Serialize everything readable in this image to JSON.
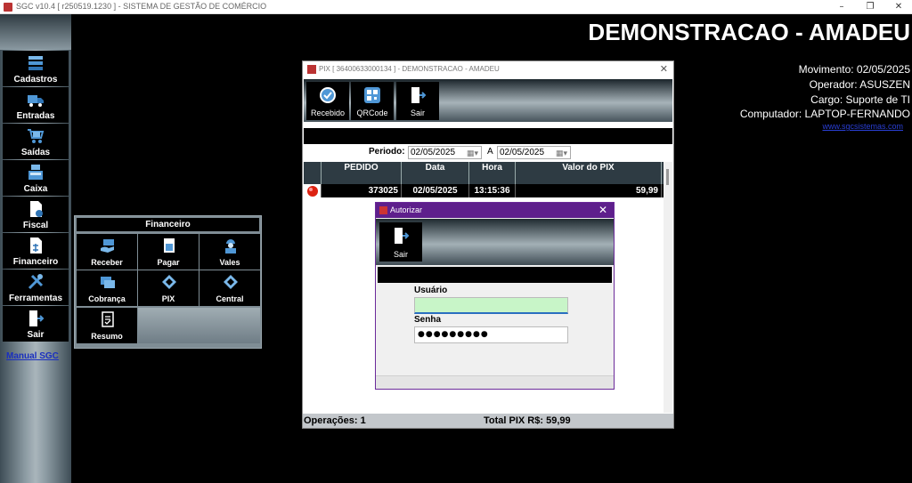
{
  "app": {
    "title": "SGC v10.4 [ r250519.1230 ] - SISTEMA DE GESTÃO DE COMÉRCIO",
    "window_controls": [
      "–",
      "❐",
      "✕"
    ]
  },
  "sidebar": {
    "items": [
      {
        "label": "Cadastros",
        "icon": "stack-icon"
      },
      {
        "label": "Entradas",
        "icon": "truck-icon"
      },
      {
        "label": "Saídas",
        "icon": "cart-icon"
      },
      {
        "label": "Caixa",
        "icon": "cash-register-icon"
      },
      {
        "label": "Fiscal",
        "icon": "document-icon"
      },
      {
        "label": "Financeiro",
        "icon": "finance-document-icon"
      },
      {
        "label": "Ferramentas",
        "icon": "tools-icon"
      },
      {
        "label": "Sair",
        "icon": "exit-door-icon"
      }
    ],
    "manual_link": "Manual SGC"
  },
  "financeiro_panel": {
    "title": "Financeiro",
    "buttons": [
      {
        "label": "Receber",
        "icon": "receive-money-icon"
      },
      {
        "label": "Pagar",
        "icon": "pay-icon"
      },
      {
        "label": "Vales",
        "icon": "worker-icon"
      },
      {
        "label": "Cobrança",
        "icon": "billing-icon"
      },
      {
        "label": "PIX",
        "icon": "pix-icon"
      },
      {
        "label": "Central",
        "icon": "pix-icon"
      },
      {
        "label": "Resumo",
        "icon": "summary-icon"
      }
    ]
  },
  "header": {
    "company": "DEMONSTRACAO - AMADEU",
    "movimento": "Movimento: 02/05/2025",
    "operador": "Operador: ASUSZEN",
    "cargo": "Cargo: Suporte de TI",
    "computador": "Computador: LAPTOP-FERNANDO",
    "site": "www.sgcsistemas.com"
  },
  "pix_window": {
    "title": "PIX [ 36400633000134 ] - DEMONSTRACAO - AMADEU",
    "toolbar": [
      {
        "label": "Recebido",
        "icon": "check-circle-icon"
      },
      {
        "label": "QRCode",
        "icon": "qrcode-icon"
      },
      {
        "label": "Sair",
        "icon": "exit-door-icon"
      }
    ],
    "period_label": "Periodo:",
    "date_from": "02/05/2025",
    "separator": "A",
    "date_to": "02/05/2025",
    "columns": [
      "PEDIDO",
      "Data",
      "Hora",
      "Valor do PIX"
    ],
    "rows": [
      {
        "pedido": "373025",
        "data": "02/05/2025",
        "hora": "13:15:36",
        "valor": "59,99"
      }
    ],
    "footer": {
      "operacoes": "Operações: 1",
      "total": "Total PIX R$: 59,99"
    }
  },
  "auth_dialog": {
    "title": "Autorizar",
    "sair_label": "Sair",
    "usuario_label": "Usuário",
    "usuario_value": "",
    "senha_label": "Senha",
    "senha_value": "●●●●●●●●●",
    "close": "✕"
  }
}
